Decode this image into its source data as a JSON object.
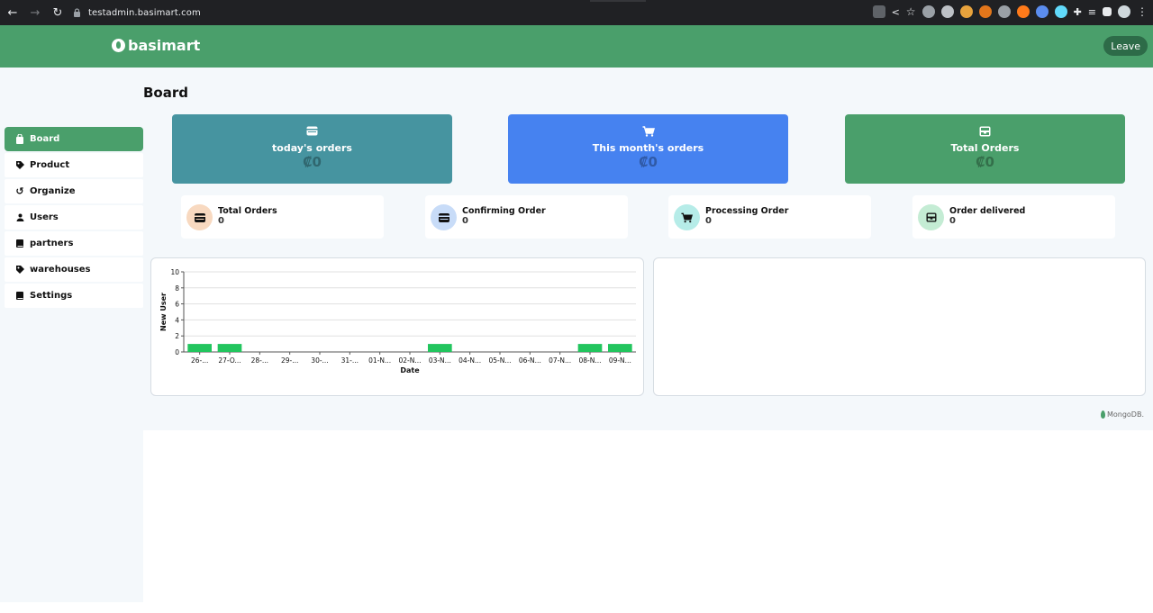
{
  "browser": {
    "url": "testadmin.basimart.com"
  },
  "header": {
    "logo_text": "basimart",
    "leave_label": "Leave"
  },
  "page": {
    "title": "Board"
  },
  "sidebar": {
    "items": [
      {
        "label": "Board",
        "icon": "shopping-bag-icon",
        "active": true
      },
      {
        "label": "Product",
        "icon": "tag-icon",
        "active": false
      },
      {
        "label": "Organize",
        "icon": "refresh-icon",
        "active": false
      },
      {
        "label": "Users",
        "icon": "user-icon",
        "active": false
      },
      {
        "label": "partners",
        "icon": "book-icon",
        "active": false
      },
      {
        "label": "warehouses",
        "icon": "tag-icon",
        "active": false
      },
      {
        "label": "Settings",
        "icon": "book-icon",
        "active": false
      }
    ]
  },
  "cards": [
    {
      "title": "today's orders",
      "value": "₡0",
      "icon": "wallet-icon",
      "color": "#4694a0"
    },
    {
      "title": "This month's orders",
      "value": "₡0",
      "icon": "cart-icon",
      "color": "#4682f0"
    },
    {
      "title": "Total Orders",
      "value": "₡0",
      "icon": "inbox-icon",
      "color": "#4a9f6b"
    }
  ],
  "stats": [
    {
      "label": "Total Orders",
      "value": "0",
      "icon": "wallet-icon",
      "badge_color": "#f8d9c0"
    },
    {
      "label": "Confirming Order",
      "value": "0",
      "icon": "wallet-icon",
      "badge_color": "#c8dcf8"
    },
    {
      "label": "Processing Order",
      "value": "0",
      "icon": "cart-icon",
      "badge_color": "#b6ece8"
    },
    {
      "label": "Order delivered",
      "value": "0",
      "icon": "inbox-icon",
      "badge_color": "#c4ecd4"
    }
  ],
  "chart_data": {
    "type": "bar",
    "categories": [
      "26-...",
      "27-O...",
      "28-...",
      "29-...",
      "30-...",
      "31-...",
      "01-N...",
      "02-N...",
      "03-N...",
      "04-N...",
      "05-N...",
      "06-N...",
      "07-N...",
      "08-N...",
      "09-N..."
    ],
    "values": [
      1,
      1,
      0,
      0,
      0,
      0,
      0,
      0,
      1,
      0,
      0,
      0,
      0,
      1,
      1
    ],
    "xlabel": "Date",
    "ylabel": "New User",
    "ylim": [
      0,
      10
    ],
    "yticks": [
      0,
      2,
      4,
      6,
      8,
      10
    ],
    "grid": true,
    "bar_color": "#22c55e"
  },
  "footer": {
    "mongo_label": "MongoDB."
  }
}
